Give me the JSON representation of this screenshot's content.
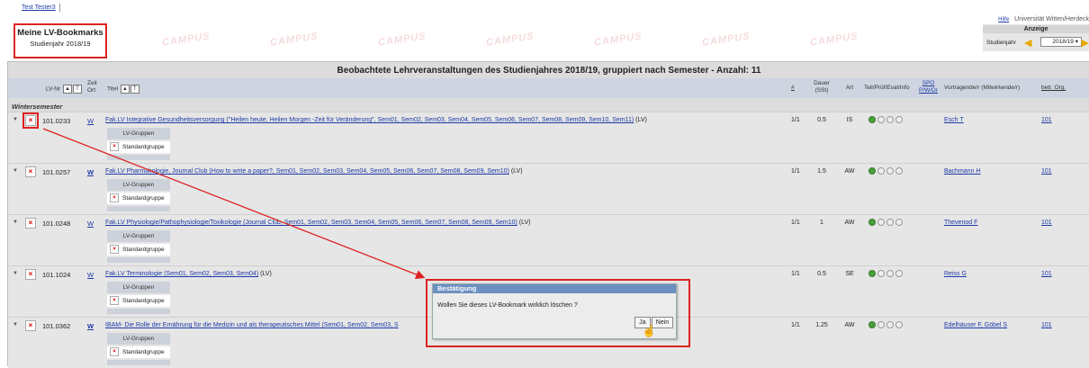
{
  "user": {
    "tab": "Test Tester3"
  },
  "top_right": {
    "help_link": "Hilfe",
    "institution": "Universität Witten/Herdeck"
  },
  "page": {
    "title": "Meine LV-Bookmarks",
    "subtitle": "Studienjahr 2018/19"
  },
  "anzeige": {
    "title": "Anzeige",
    "studienjahr_label": "Studienjahr",
    "selected_year": "2018/19",
    "select_arrow": "▾"
  },
  "panel": {
    "header": "Beobachtete Lehrveranstaltungen des Studienjahres 2018/19, gruppiert nach Semester - Anzahl: 11",
    "semester": "Wintersemester"
  },
  "columns": {
    "lv_nr": "LV-Nr",
    "zeit": "Zeit",
    "ort": "Ort",
    "titel": "Titel",
    "hash": "#",
    "dauer": "Dauer",
    "sst": "(SSt)",
    "art": "Art",
    "teil": "Teil/Prüf/Eval/Info",
    "spo": "SPO",
    "pwdr": "P/W/Dr",
    "vortragende": "Vortragende/r (Mitwirkende/r)",
    "betr_org": "betr. Org."
  },
  "group_labels": {
    "lv_gruppen": "LV-Gruppen",
    "standardgruppe": "Standardgruppe"
  },
  "rows": [
    {
      "nr": "101.0233",
      "w": "W",
      "title": "Fak.LV Integrative Gesundheitsversorgung (\"Heilen heute, Heilen Morgen -Zeit für Veränderung\", Sem01, Sem02, Sem03, Sem04, Sem05, Sem06, Sem07, Sem08, Sem09, Sem10, Sem11)",
      "suffix": " (LV)",
      "num": "1/1",
      "dauer": "0.5",
      "art": "IS",
      "lecturer": "Esch T",
      "org": "101"
    },
    {
      "nr": "101.0257",
      "w": "W",
      "title": "Fak.LV Pharmakologie, Journal Club (How to write a paper?, Sem01, Sem02, Sem03, Sem04, Sem05, Sem06, Sem07, Sem08, Sem09, Sem10)",
      "suffix": " (LV)",
      "num": "1/1",
      "dauer": "1.5",
      "art": "AW",
      "lecturer": "Bachmann H",
      "org": "101"
    },
    {
      "nr": "101.0248",
      "w": "W",
      "title": "Fak.LV Physiologie/Pathophysiologie/Toxikologie (Journal Club, Sem01, Sem02, Sem03, Sem04, Sem05, Sem06, Sem07, Sem08, Sem09, Sem10)",
      "suffix": " (LV)",
      "num": "1/1",
      "dauer": "1",
      "art": "AW",
      "lecturer": "Thevenod F",
      "org": "101"
    },
    {
      "nr": "101.1024",
      "w": "W",
      "title": "Fak.LV Terminologie (Sem01, Sem02, Sem03, Sem04)",
      "suffix": " (LV)",
      "num": "1/1",
      "dauer": "0.5",
      "art": "SE",
      "lecturer": "Reiss G",
      "org": "101"
    },
    {
      "nr": "101.0362",
      "w": "W",
      "title": "IBAM- Die Rolle der Ernährung für die Medizin und als therapeutisches Mittel (Sem01, Sem02, Sem03, S",
      "suffix": "",
      "num": "1/1",
      "dauer": "1.25",
      "art": "AW",
      "lecturer": "Edelhäuser F, Göbel S",
      "org": "101"
    }
  ],
  "dialog": {
    "title": "Bestätigung",
    "message": "Wollen Sie dieses LV-Bookmark wirklich löschen ?",
    "yes": "Ja",
    "no": "Nein"
  },
  "icons": {
    "delete": "×",
    "caret": "▼",
    "sort_up": "▲",
    "sort_down": "T",
    "arrow_left": "◀",
    "arrow_right": "▶",
    "cursor": "☝"
  },
  "colors": {
    "highlight": "#dd2222",
    "link": "#1d3aa6",
    "header_bar": "#cfd5e0",
    "dialog_title": "#6d8fc0"
  }
}
